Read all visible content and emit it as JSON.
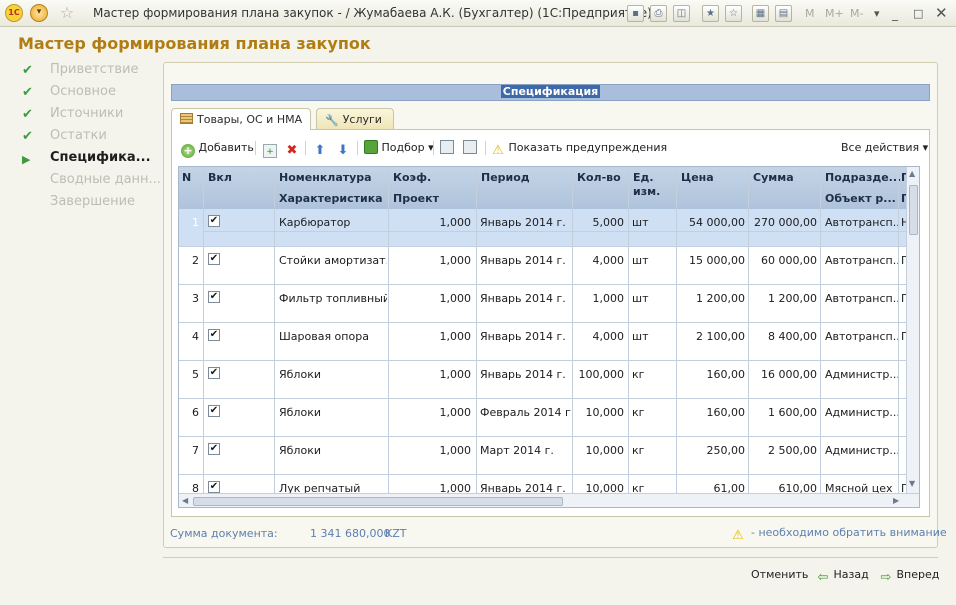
{
  "window": {
    "title": "Мастер формирования плана закупок - / Жумабаева А.К. (Бухгалтер)  (1С:Предприятие)",
    "logo": "1С",
    "menu_glyph": "▾",
    "memory_buttons": [
      "M",
      "M+",
      "M-"
    ]
  },
  "heading": "Мастер формирования плана закупок",
  "steps": [
    {
      "label": "Приветствие",
      "state": "done"
    },
    {
      "label": "Основное",
      "state": "done"
    },
    {
      "label": "Источники",
      "state": "done"
    },
    {
      "label": "Остатки",
      "state": "done"
    },
    {
      "label": "Специфика...",
      "state": "current"
    },
    {
      "label": "Сводные данн...",
      "state": "future"
    },
    {
      "label": "Завершение",
      "state": "future"
    }
  ],
  "section_title": "Спецификация",
  "tabs": [
    {
      "label": "Товары, ОС и НМА",
      "icon": "table-icon",
      "active": true
    },
    {
      "label": "Услуги",
      "icon": "wrench-icon",
      "active": false
    }
  ],
  "toolbar": {
    "add": "Добавить",
    "pick": "Подбор",
    "show_warnings": "Показать предупреждения",
    "all_actions": "Все действия"
  },
  "grid": {
    "headers": {
      "n": "N",
      "incl": "Вкл",
      "nomenclature": "Номенклатура",
      "characteristic": "Характеристика",
      "coef": "Коэф.",
      "project": "Проект",
      "period": "Период",
      "qty": "Кол-во",
      "unit": "Ед. изм.",
      "price": "Цена",
      "sum": "Сумма",
      "dept": "Подразде...",
      "object": "Объект р...",
      "extra": "Г"
    },
    "rows": [
      {
        "n": "1",
        "checked": true,
        "name": "Карбюратор",
        "coef": "1,000",
        "period": "Январь 2014 г.",
        "qty": "5,000",
        "unit": "шт",
        "price": "54 000,00",
        "sum": "270 000,00",
        "dept": "Автотрансп...",
        "extra": "Н"
      },
      {
        "n": "2",
        "checked": true,
        "name": "Стойки амортизат...",
        "coef": "1,000",
        "period": "Январь 2014 г.",
        "qty": "4,000",
        "unit": "шт",
        "price": "15 000,00",
        "sum": "60 000,00",
        "dept": "Автотрансп...",
        "extra": "Г"
      },
      {
        "n": "3",
        "checked": true,
        "name": "Фильтр топливный",
        "coef": "1,000",
        "period": "Январь 2014 г.",
        "qty": "1,000",
        "unit": "шт",
        "price": "1 200,00",
        "sum": "1 200,00",
        "dept": "Автотрансп...",
        "extra": "Г"
      },
      {
        "n": "4",
        "checked": true,
        "name": "Шаровая опора",
        "coef": "1,000",
        "period": "Январь 2014 г.",
        "qty": "4,000",
        "unit": "шт",
        "price": "2 100,00",
        "sum": "8 400,00",
        "dept": "Автотрансп...",
        "extra": "Г"
      },
      {
        "n": "5",
        "checked": true,
        "name": "Яблоки",
        "coef": "1,000",
        "period": "Январь 2014 г.",
        "qty": "100,000",
        "unit": "кг",
        "price": "160,00",
        "sum": "16 000,00",
        "dept": "Администр...",
        "extra": ""
      },
      {
        "n": "6",
        "checked": true,
        "name": "Яблоки",
        "coef": "1,000",
        "period": "Февраль 2014 г.",
        "qty": "10,000",
        "unit": "кг",
        "price": "160,00",
        "sum": "1 600,00",
        "dept": "Администр...",
        "extra": ""
      },
      {
        "n": "7",
        "checked": true,
        "name": "Яблоки",
        "coef": "1,000",
        "period": "Март 2014 г.",
        "qty": "10,000",
        "unit": "кг",
        "price": "250,00",
        "sum": "2 500,00",
        "dept": "Администр...",
        "extra": ""
      },
      {
        "n": "8",
        "checked": true,
        "name": "Лук репчатый",
        "coef": "1,000",
        "period": "Январь 2014 г.",
        "qty": "10,000",
        "unit": "кг",
        "price": "61,00",
        "sum": "610,00",
        "dept": "Мясной цех",
        "extra": "Г"
      }
    ]
  },
  "footer": {
    "sum_label": "Сумма документа:",
    "sum_value": "1 341 680,000",
    "currency": "KZT",
    "hint": "- необходимо обратить внимание"
  },
  "nav": {
    "cancel": "Отменить",
    "back": "Назад",
    "next": "Вперед"
  },
  "colors": {
    "heading": "#b07d12",
    "header_bar": "#a9bedb",
    "selected_row": "#cfe0f5",
    "step_check": "#3d9a3d"
  }
}
